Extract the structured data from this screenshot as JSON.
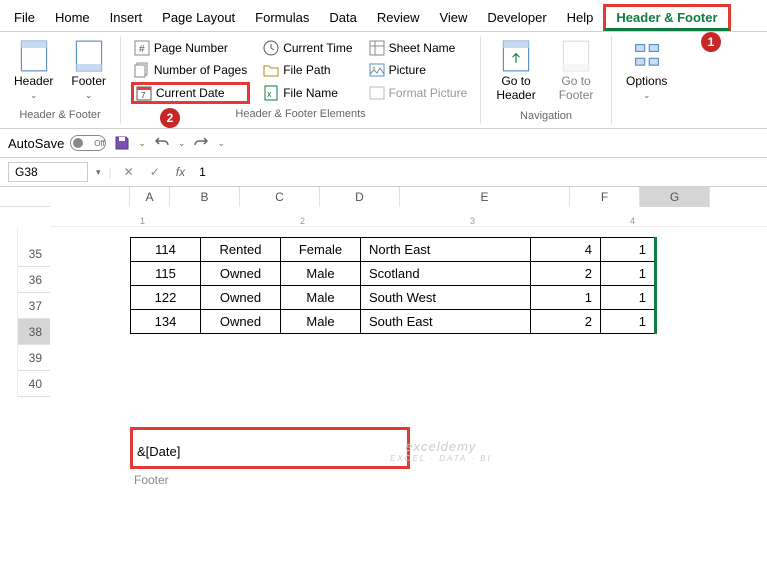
{
  "tabs": {
    "file": "File",
    "home": "Home",
    "insert": "Insert",
    "page_layout": "Page Layout",
    "formulas": "Formulas",
    "data": "Data",
    "review": "Review",
    "view": "View",
    "developer": "Developer",
    "help": "Help",
    "header_footer": "Header & Footer"
  },
  "callouts": {
    "one": "1",
    "two": "2"
  },
  "ribbon": {
    "hf_group": {
      "header": "Header",
      "footer": "Footer",
      "label": "Header & Footer"
    },
    "elements": {
      "page_number": "Page Number",
      "current_time": "Current Time",
      "sheet_name": "Sheet Name",
      "number_of_pages": "Number of Pages",
      "file_path": "File Path",
      "picture": "Picture",
      "current_date": "Current Date",
      "file_name": "File Name",
      "format_picture": "Format Picture",
      "label": "Header & Footer Elements"
    },
    "nav": {
      "goto_header": "Go to Header",
      "goto_footer": "Go to Footer",
      "label": "Navigation"
    },
    "options": {
      "options": "Options",
      "label": ""
    }
  },
  "qat": {
    "autosave": "AutoSave",
    "off": "Off"
  },
  "formula_bar": {
    "name_box": "G38",
    "value": "1"
  },
  "columns": [
    "A",
    "B",
    "C",
    "D",
    "E",
    "F",
    "G"
  ],
  "rows_visible": [
    "35",
    "36",
    "37",
    "38",
    "39",
    "40"
  ],
  "active_row": "38",
  "ruler": {
    "r1": "1",
    "r2": "2",
    "r3": "3",
    "r4": "4"
  },
  "table": {
    "rows": [
      {
        "id": "114",
        "tenure": "Rented",
        "gender": "Female",
        "region": "North East",
        "v1": "4",
        "v2": "1"
      },
      {
        "id": "115",
        "tenure": "Owned",
        "gender": "Male",
        "region": "Scotland",
        "v1": "2",
        "v2": "1"
      },
      {
        "id": "122",
        "tenure": "Owned",
        "gender": "Male",
        "region": "South West",
        "v1": "1",
        "v2": "1"
      },
      {
        "id": "134",
        "tenure": "Owned",
        "gender": "Male",
        "region": "South East",
        "v1": "2",
        "v2": "1"
      }
    ]
  },
  "footer": {
    "code": "&[Date]",
    "label": "Footer"
  },
  "watermark": {
    "main": "exceldemy",
    "sub": "EXCEL · DATA · BI"
  }
}
